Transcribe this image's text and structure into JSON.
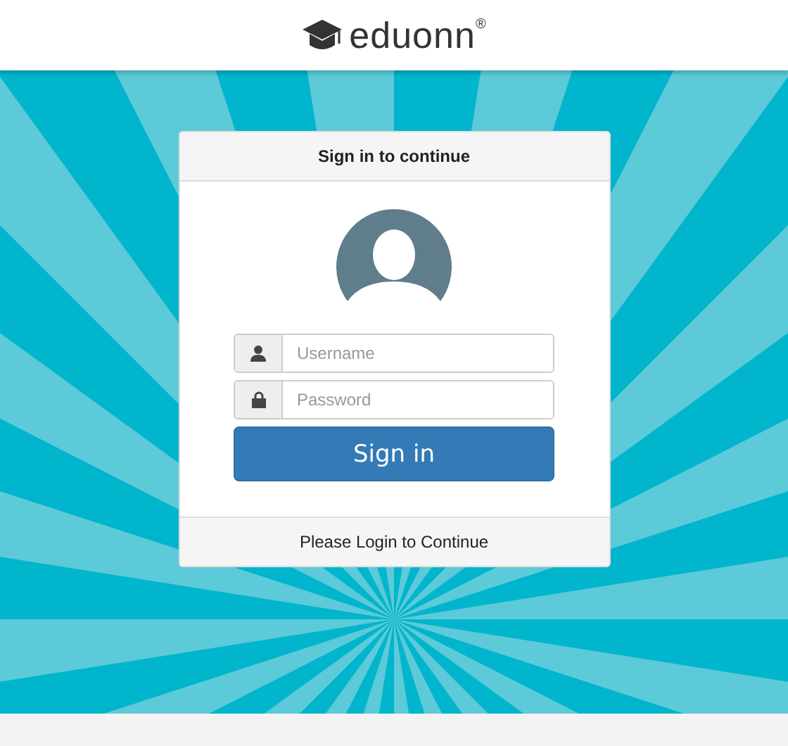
{
  "header": {
    "logo": "eduonn$^{®}$"
  },
  "login_card": {
    "title": "Sign in to continue",
    "fields": [
      {
        "kind": "user",
        "placeholder": "Username"
      },
      {
        "kind": "lock",
        "placeholder": "Password"
      }
    ],
    "button": "Sign in",
    "footer": "Please Login to Continue"
  }
}
